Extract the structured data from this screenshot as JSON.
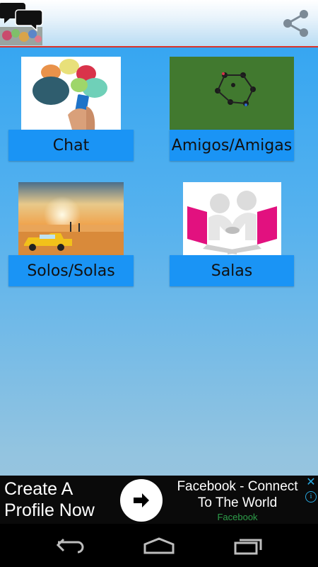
{
  "appbar": {
    "logo_icon": "chat-bubbles-logo-icon",
    "share_icon": "share-icon"
  },
  "tiles": [
    {
      "label": "Chat",
      "image": "speech-bubbles-phone-image"
    },
    {
      "label": "Amigos/Amigas",
      "image": "people-star-grass-image"
    },
    {
      "label": "Solos/Solas",
      "image": "desert-taxi-image"
    },
    {
      "label": "Salas",
      "image": "laptops-handshake-image"
    }
  ],
  "ad": {
    "left_text_line1": "Create A",
    "left_text_line2": "Profile Now",
    "title_line1": "Facebook - Connect",
    "title_line2": "To The World",
    "source": "Facebook",
    "close_icon": "close-icon",
    "info_icon": "info-icon",
    "arrow_icon": "arrow-right-icon"
  },
  "navbar": {
    "back_icon": "back-icon",
    "home_icon": "home-icon",
    "recents_icon": "recents-icon"
  },
  "colors": {
    "tile_label_bg": "#1a94f5",
    "appbar_divider": "#d9342b",
    "ad_source": "#2e9e4a"
  }
}
